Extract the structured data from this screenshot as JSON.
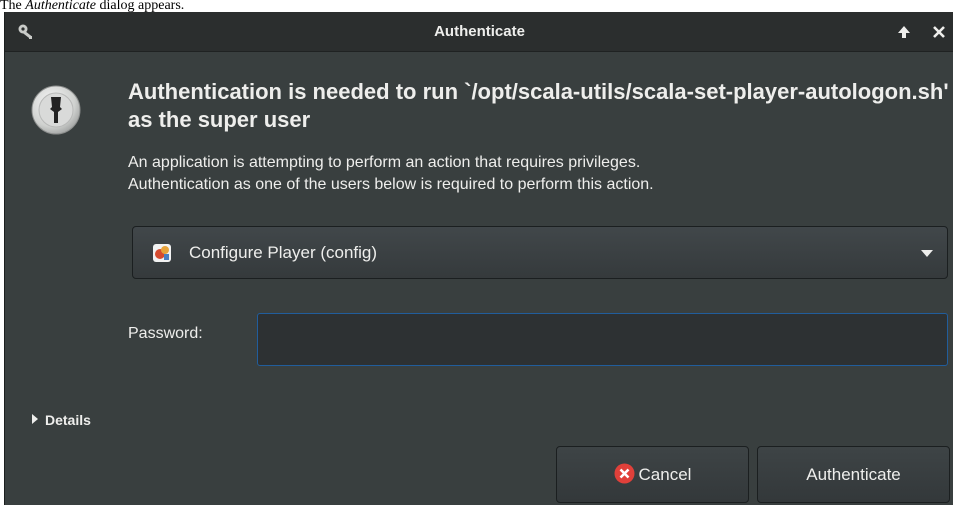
{
  "caption": {
    "prefix": "The ",
    "emphasis": "Authenticate",
    "suffix": " dialog appears."
  },
  "window": {
    "title": "Authenticate",
    "icons": {
      "title_icon": "keys-icon",
      "maximize": "up-arrow-icon",
      "close": "close-icon"
    }
  },
  "dialog": {
    "heading": "Authentication is needed to run `/opt/scala-utils/scala-set-player-autologon.sh' as the super user",
    "message_line1": "An application is attempting to perform an action that requires privileges.",
    "message_line2": "Authentication as one of the users below is required to perform this action.",
    "user_select": {
      "selected": "Configure Player (config)",
      "icon": "user-icon"
    },
    "password_label": "Password:",
    "password_value": "",
    "details_label": "Details",
    "cancel_label": "Cancel",
    "authenticate_label": "Authenticate"
  },
  "colors": {
    "background": "#393f3f",
    "titlebar": "#2b2e2e",
    "text": "#eeeeec",
    "focus_border": "#215d9c",
    "cancel_icon": "#e0403a"
  }
}
